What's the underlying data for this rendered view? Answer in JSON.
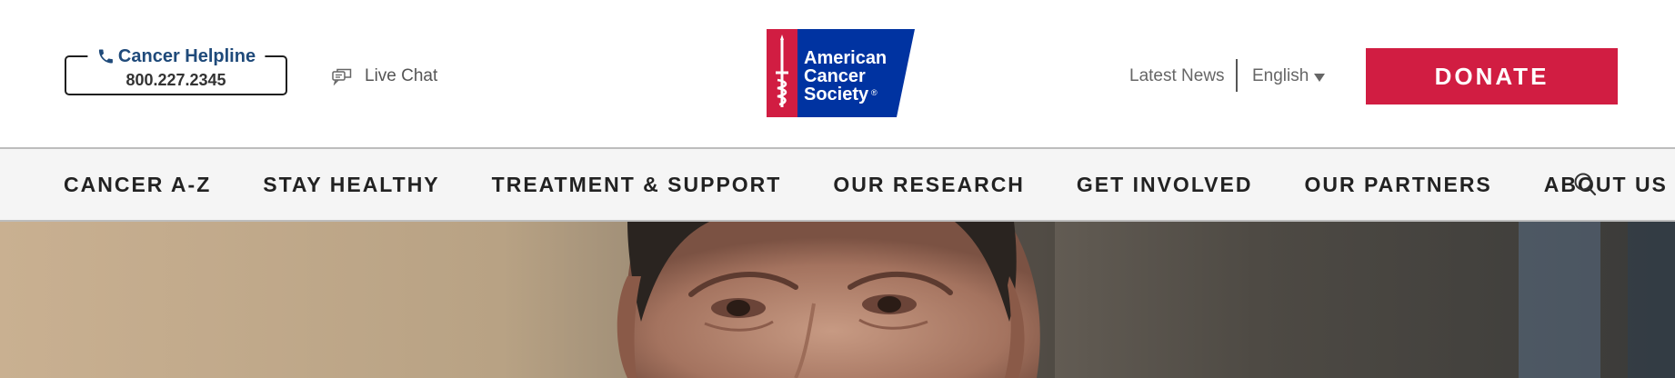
{
  "header": {
    "helpline": {
      "title": "Cancer Helpline",
      "number": "800.227.2345",
      "icon": "phone-icon"
    },
    "live_chat": {
      "label": "Live Chat",
      "icon": "chat-bubbles-icon"
    },
    "logo": {
      "lines": [
        "American",
        "Cancer",
        "Society"
      ],
      "mark": "®",
      "icon": "sword-and-snake-icon"
    },
    "latest_news": "Latest News",
    "language": {
      "selected": "English",
      "icon": "caret-down-icon"
    },
    "donate_label": "DONATE"
  },
  "nav": {
    "items": [
      {
        "label": "CANCER A-Z"
      },
      {
        "label": "STAY HEALTHY"
      },
      {
        "label": "TREATMENT & SUPPORT"
      },
      {
        "label": "OUR RESEARCH"
      },
      {
        "label": "GET INVOLVED"
      },
      {
        "label": "OUR PARTNERS"
      },
      {
        "label": "ABOUT US"
      }
    ],
    "search_icon": "search-icon"
  },
  "colors": {
    "brand_red": "#d11d42",
    "brand_blue": "#0033a1",
    "helpline_text": "#1f4a7a",
    "nav_background": "#f5f5f5"
  }
}
